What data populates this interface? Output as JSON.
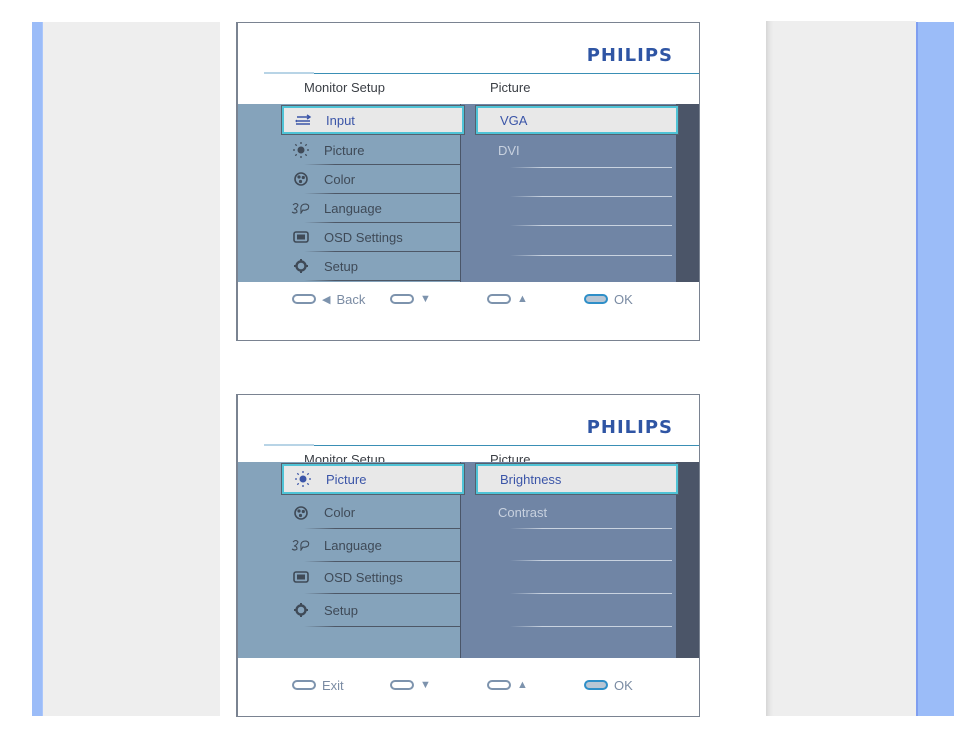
{
  "page": {
    "colors": {
      "side_strip": "#9bbcf8",
      "side_panel": "#eeeeee",
      "brand": "#2f55a4",
      "selected_border": "#4fc3d6"
    }
  },
  "osd_screens": [
    {
      "brand": "PHILIPS",
      "header_left": "Monitor Setup",
      "header_right": "Picture",
      "main_menu": [
        {
          "icon": "input-icon",
          "label": "Input",
          "selected": true
        },
        {
          "icon": "picture-icon",
          "label": "Picture",
          "selected": false
        },
        {
          "icon": "color-icon",
          "label": "Color",
          "selected": false
        },
        {
          "icon": "language-icon",
          "label": "Language",
          "selected": false
        },
        {
          "icon": "osd-settings-icon",
          "label": "OSD Settings",
          "selected": false
        },
        {
          "icon": "setup-icon",
          "label": "Setup",
          "selected": false
        }
      ],
      "sub_menu": [
        {
          "label": "VGA",
          "selected": true
        },
        {
          "label": "DVI",
          "selected": false
        }
      ],
      "footer": [
        {
          "icon": "button-icon",
          "glyph": "◀",
          "label": "Back"
        },
        {
          "icon": "button-icon",
          "glyph": "▼",
          "label": ""
        },
        {
          "icon": "button-icon",
          "glyph": "▲",
          "label": ""
        },
        {
          "icon": "ok-button-icon",
          "glyph": "",
          "label": "OK"
        }
      ]
    },
    {
      "brand": "PHILIPS",
      "header_left": "Monitor Setup",
      "header_right": "Picture",
      "main_menu": [
        {
          "icon": "picture-icon",
          "label": "Picture",
          "selected": true
        },
        {
          "icon": "color-icon",
          "label": "Color",
          "selected": false
        },
        {
          "icon": "language-icon",
          "label": "Language",
          "selected": false
        },
        {
          "icon": "osd-settings-icon",
          "label": "OSD Settings",
          "selected": false
        },
        {
          "icon": "setup-icon",
          "label": "Setup",
          "selected": false
        }
      ],
      "sub_menu": [
        {
          "label": "Brightness",
          "selected": true
        },
        {
          "label": "Contrast",
          "selected": false
        }
      ],
      "footer": [
        {
          "icon": "button-icon",
          "glyph": "",
          "label": "Exit"
        },
        {
          "icon": "button-icon",
          "glyph": "▼",
          "label": ""
        },
        {
          "icon": "button-icon",
          "glyph": "▲",
          "label": ""
        },
        {
          "icon": "ok-button-icon",
          "glyph": "",
          "label": "OK"
        }
      ]
    }
  ]
}
